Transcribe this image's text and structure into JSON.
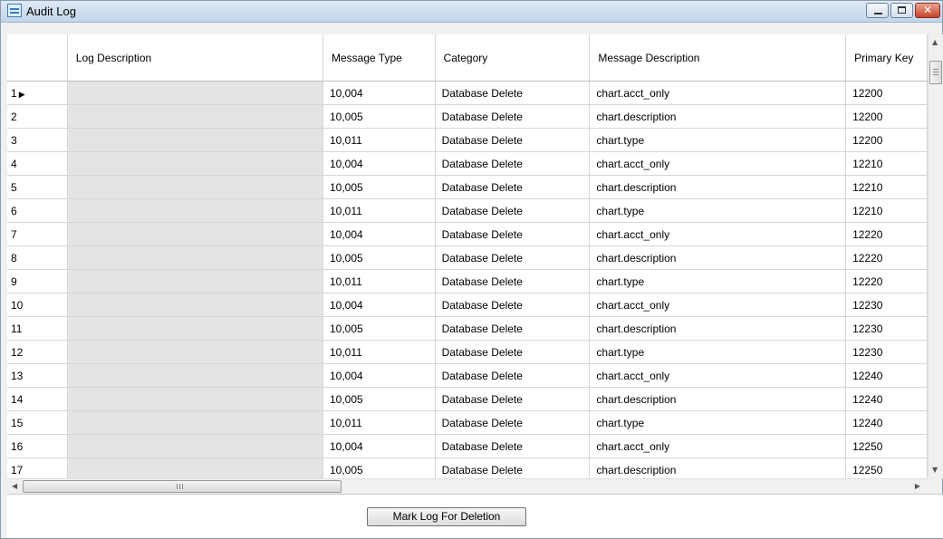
{
  "window": {
    "title": "Audit Log",
    "controls": {
      "close_glyph": "✕"
    }
  },
  "grid": {
    "columns": [
      "",
      "Log Description",
      "Message Type",
      "Category",
      "Message Description",
      "Primary Key"
    ],
    "current_row_marker": "▶",
    "rows": [
      {
        "row": "1",
        "log_description": "",
        "message_type": "10,004",
        "category": "Database Delete",
        "message_description": "chart.acct_only",
        "primary_key": "12200"
      },
      {
        "row": "2",
        "log_description": "",
        "message_type": "10,005",
        "category": "Database Delete",
        "message_description": "chart.description",
        "primary_key": "12200"
      },
      {
        "row": "3",
        "log_description": "",
        "message_type": "10,011",
        "category": "Database Delete",
        "message_description": "chart.type",
        "primary_key": "12200"
      },
      {
        "row": "4",
        "log_description": "",
        "message_type": "10,004",
        "category": "Database Delete",
        "message_description": "chart.acct_only",
        "primary_key": "12210"
      },
      {
        "row": "5",
        "log_description": "",
        "message_type": "10,005",
        "category": "Database Delete",
        "message_description": "chart.description",
        "primary_key": "12210"
      },
      {
        "row": "6",
        "log_description": "",
        "message_type": "10,011",
        "category": "Database Delete",
        "message_description": "chart.type",
        "primary_key": "12210"
      },
      {
        "row": "7",
        "log_description": "",
        "message_type": "10,004",
        "category": "Database Delete",
        "message_description": "chart.acct_only",
        "primary_key": "12220"
      },
      {
        "row": "8",
        "log_description": "",
        "message_type": "10,005",
        "category": "Database Delete",
        "message_description": "chart.description",
        "primary_key": "12220"
      },
      {
        "row": "9",
        "log_description": "",
        "message_type": "10,011",
        "category": "Database Delete",
        "message_description": "chart.type",
        "primary_key": "12220"
      },
      {
        "row": "10",
        "log_description": "",
        "message_type": "10,004",
        "category": "Database Delete",
        "message_description": "chart.acct_only",
        "primary_key": "12230"
      },
      {
        "row": "11",
        "log_description": "",
        "message_type": "10,005",
        "category": "Database Delete",
        "message_description": "chart.description",
        "primary_key": "12230"
      },
      {
        "row": "12",
        "log_description": "",
        "message_type": "10,011",
        "category": "Database Delete",
        "message_description": "chart.type",
        "primary_key": "12230"
      },
      {
        "row": "13",
        "log_description": "",
        "message_type": "10,004",
        "category": "Database Delete",
        "message_description": "chart.acct_only",
        "primary_key": "12240"
      },
      {
        "row": "14",
        "log_description": "",
        "message_type": "10,005",
        "category": "Database Delete",
        "message_description": "chart.description",
        "primary_key": "12240"
      },
      {
        "row": "15",
        "log_description": "",
        "message_type": "10,011",
        "category": "Database Delete",
        "message_description": "chart.type",
        "primary_key": "12240"
      },
      {
        "row": "16",
        "log_description": "",
        "message_type": "10,004",
        "category": "Database Delete",
        "message_description": "chart.acct_only",
        "primary_key": "12250"
      },
      {
        "row": "17",
        "log_description": "",
        "message_type": "10,005",
        "category": "Database Delete",
        "message_description": "chart.description",
        "primary_key": "12250"
      }
    ]
  },
  "scrollbars": {
    "up_arrow": "▲",
    "down_arrow": "▼",
    "left_arrow": "◀",
    "right_arrow": "▶"
  },
  "footer": {
    "mark_button_label": "Mark Log For Deletion"
  }
}
